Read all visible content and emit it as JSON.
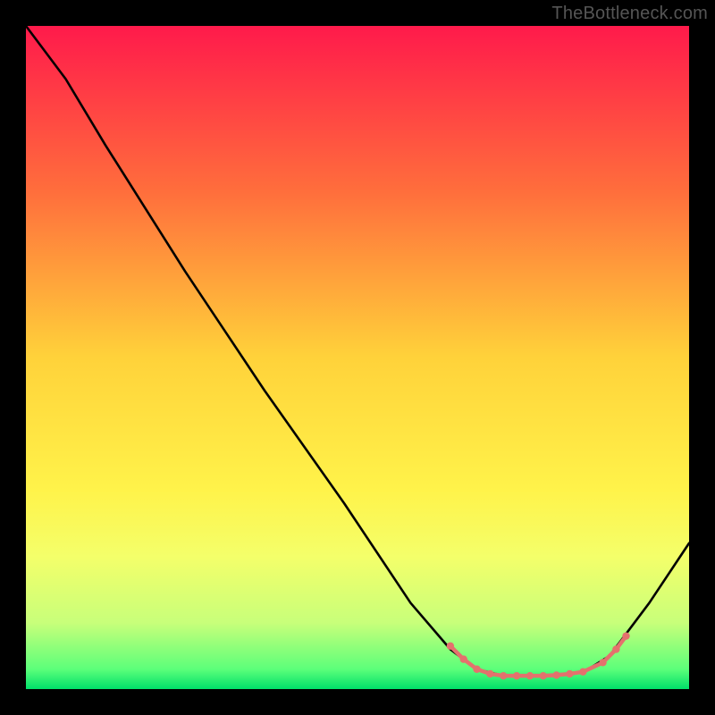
{
  "watermark": "TheBottleneck.com",
  "chart_data": {
    "type": "line",
    "title": "",
    "xlabel": "",
    "ylabel": "",
    "xlim": [
      0,
      100
    ],
    "ylim": [
      0,
      100
    ],
    "grid": false,
    "legend": false,
    "background_gradient_stops": [
      {
        "offset": 0.0,
        "color": "#ff1a4b"
      },
      {
        "offset": 0.25,
        "color": "#ff6e3c"
      },
      {
        "offset": 0.5,
        "color": "#ffd23a"
      },
      {
        "offset": 0.7,
        "color": "#fff34a"
      },
      {
        "offset": 0.8,
        "color": "#f4ff6a"
      },
      {
        "offset": 0.9,
        "color": "#c8ff7a"
      },
      {
        "offset": 0.97,
        "color": "#5cff7a"
      },
      {
        "offset": 1.0,
        "color": "#00e06a"
      }
    ],
    "series": [
      {
        "name": "curve",
        "color": "#000000",
        "points": [
          {
            "x": 0,
            "y": 100
          },
          {
            "x": 6,
            "y": 92
          },
          {
            "x": 12,
            "y": 82
          },
          {
            "x": 24,
            "y": 63
          },
          {
            "x": 36,
            "y": 45
          },
          {
            "x": 48,
            "y": 28
          },
          {
            "x": 58,
            "y": 13
          },
          {
            "x": 64,
            "y": 6
          },
          {
            "x": 68,
            "y": 3
          },
          {
            "x": 72,
            "y": 2
          },
          {
            "x": 78,
            "y": 2
          },
          {
            "x": 84,
            "y": 2.5
          },
          {
            "x": 88,
            "y": 5
          },
          {
            "x": 94,
            "y": 13
          },
          {
            "x": 100,
            "y": 22
          }
        ]
      }
    ],
    "scatter": {
      "name": "dots",
      "color": "#e4716d",
      "radius": 4.2,
      "points": [
        {
          "x": 64,
          "y": 6.5
        },
        {
          "x": 66,
          "y": 4.5
        },
        {
          "x": 68,
          "y": 3.0
        },
        {
          "x": 70,
          "y": 2.3
        },
        {
          "x": 72,
          "y": 2.0
        },
        {
          "x": 74,
          "y": 2.0
        },
        {
          "x": 76,
          "y": 2.0
        },
        {
          "x": 78,
          "y": 2.0
        },
        {
          "x": 80,
          "y": 2.1
        },
        {
          "x": 82,
          "y": 2.3
        },
        {
          "x": 84,
          "y": 2.6
        },
        {
          "x": 87,
          "y": 4.0
        },
        {
          "x": 89,
          "y": 6.0
        },
        {
          "x": 90.5,
          "y": 8.0
        }
      ]
    }
  }
}
